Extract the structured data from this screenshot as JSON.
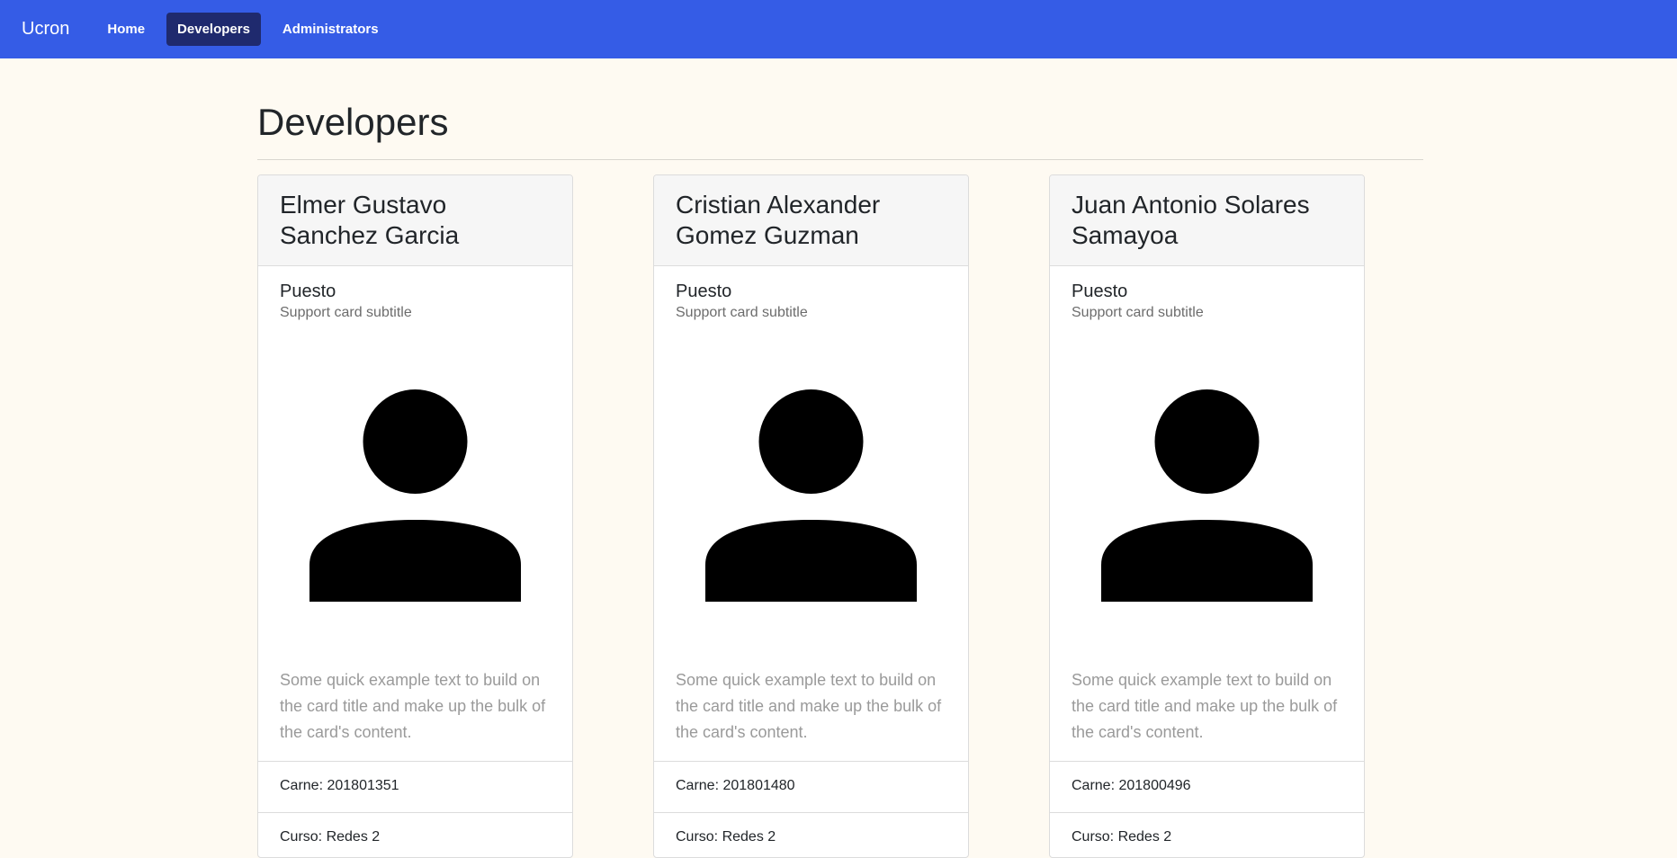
{
  "nav": {
    "brand": "Ucron",
    "links": [
      {
        "label": "Home"
      },
      {
        "label": "Developers"
      },
      {
        "label": "Administrators"
      }
    ]
  },
  "page": {
    "title": "Developers"
  },
  "cards": [
    {
      "name": "Elmer Gustavo Sanchez Garcia",
      "role": "Puesto",
      "subtitle": "Support card subtitle",
      "text": "Some quick example text to build on the card title and make up the bulk of the card's content.",
      "carne": "Carne: 201801351",
      "curso": "Curso: Redes 2"
    },
    {
      "name": "Cristian Alexander Gomez Guzman",
      "role": "Puesto",
      "subtitle": "Support card subtitle",
      "text": "Some quick example text to build on the card title and make up the bulk of the card's content.",
      "carne": "Carne: 201801480",
      "curso": "Curso: Redes 2"
    },
    {
      "name": "Juan Antonio Solares Samayoa",
      "role": "Puesto",
      "subtitle": "Support card subtitle",
      "text": "Some quick example text to build on the card title and make up the bulk of the card's content.",
      "carne": "Carne: 201800496",
      "curso": "Curso: Redes 2"
    }
  ],
  "colors": {
    "navbar": "#355ce6",
    "active_link": "#1f2a6e",
    "background": "#fefaf2"
  },
  "icons": {
    "avatar": "person-icon"
  }
}
